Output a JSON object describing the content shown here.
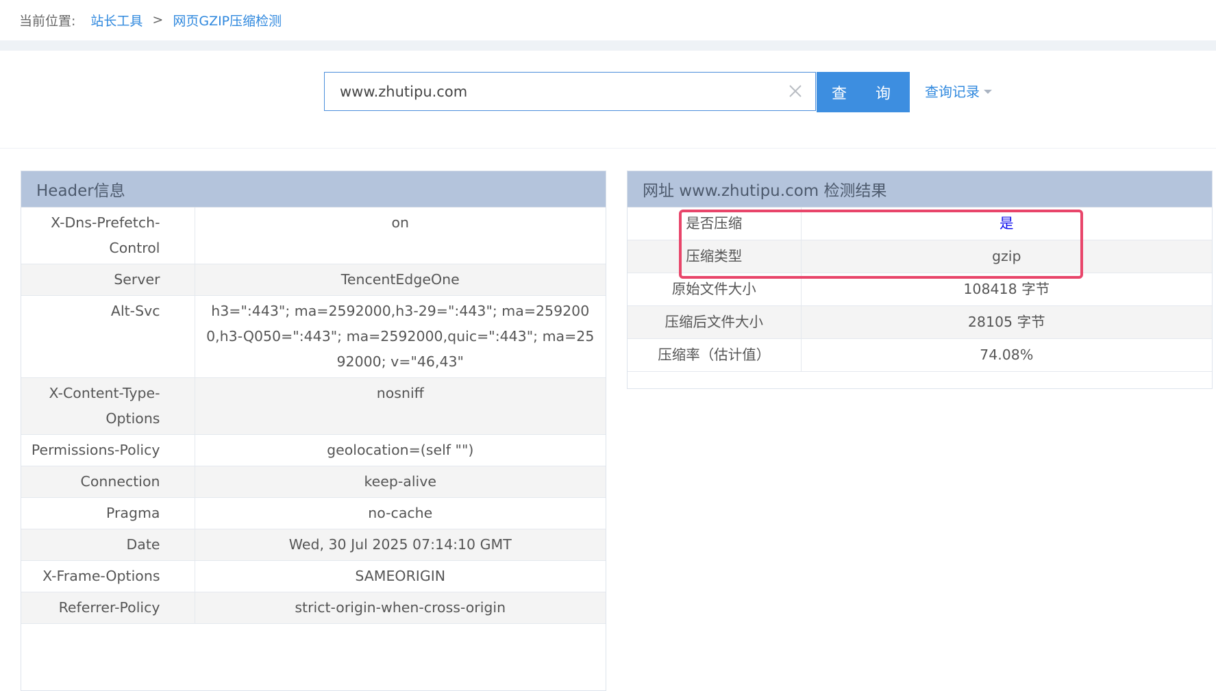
{
  "breadcrumb": {
    "label": "当前位置:",
    "items": [
      "站长工具",
      "网页GZIP压缩检测"
    ],
    "separator": ">"
  },
  "search": {
    "value": "www.zhutipu.com",
    "button_label": "查 询",
    "history_label": "查询记录"
  },
  "header_panel": {
    "title": "Header信息",
    "rows": [
      {
        "key": "X-Dns-Prefetch-Control",
        "value": "on"
      },
      {
        "key": "Server",
        "value": "TencentEdgeOne"
      },
      {
        "key": "Alt-Svc",
        "value": "h3=\":443\"; ma=2592000,h3-29=\":443\"; ma=2592000,h3-Q050=\":443\"; ma=2592000,quic=\":443\"; ma=2592000; v=\"46,43\""
      },
      {
        "key": "X-Content-Type-Options",
        "value": "nosniff"
      },
      {
        "key": "Permissions-Policy",
        "value": "geolocation=(self \"\")"
      },
      {
        "key": "Connection",
        "value": "keep-alive"
      },
      {
        "key": "Pragma",
        "value": "no-cache"
      },
      {
        "key": "Date",
        "value": "Wed, 30 Jul 2025 07:14:10 GMT"
      },
      {
        "key": "X-Frame-Options",
        "value": "SAMEORIGIN"
      },
      {
        "key": "Referrer-Policy",
        "value": "strict-origin-when-cross-origin"
      }
    ]
  },
  "result_panel": {
    "title": "网址 www.zhutipu.com 检测结果",
    "rows": [
      {
        "key": "是否压缩",
        "value": "是"
      },
      {
        "key": "压缩类型",
        "value": "gzip"
      },
      {
        "key": "原始文件大小",
        "value": "108418 字节"
      },
      {
        "key": "压缩后文件大小",
        "value": "28105 字节"
      },
      {
        "key": "压缩率（估计值）",
        "value": "74.08%"
      }
    ]
  },
  "colors": {
    "accent": "#3d8ee0",
    "link": "#2f88de",
    "panel_header": "#b4c4dc",
    "highlight_border": "#e8456a",
    "yes_value": "#1010ee"
  },
  "icons": [
    "close-icon",
    "caret-down-icon"
  ]
}
